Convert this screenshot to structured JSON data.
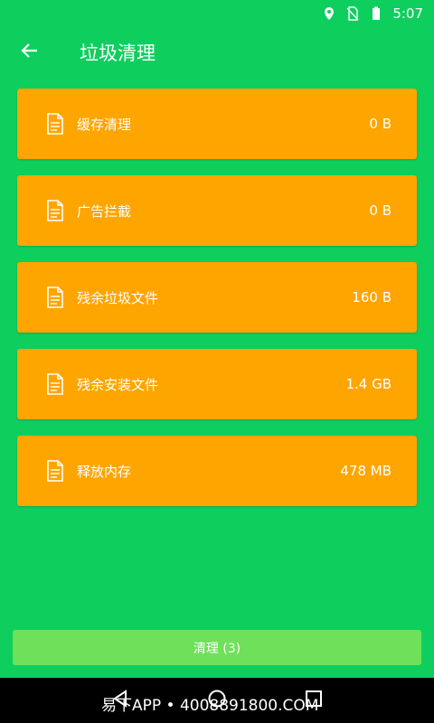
{
  "status_bar": {
    "time": "5:07",
    "icons": [
      "location-icon",
      "no-sim-icon",
      "battery-icon"
    ]
  },
  "app_bar": {
    "title": "垃圾清理",
    "back_icon": "arrow-left-icon"
  },
  "items": [
    {
      "label": "缓存清理",
      "size": "0 B",
      "icon": "document-icon"
    },
    {
      "label": "广告拦截",
      "size": "0 B",
      "icon": "document-icon"
    },
    {
      "label": "残余垃圾文件",
      "size": "160 B",
      "icon": "document-icon"
    },
    {
      "label": "残余安装文件",
      "size": "1.4 GB",
      "icon": "document-icon"
    },
    {
      "label": "释放内存",
      "size": "478 MB",
      "icon": "document-icon"
    }
  ],
  "clean_button": {
    "label": "清理 (3)"
  },
  "watermark": {
    "text": "易下APP • 4008891800.COM"
  },
  "colors": {
    "background": "#0ecf5e",
    "card": "#ffa500",
    "button": "#6fe05a",
    "nav": "#000000"
  }
}
